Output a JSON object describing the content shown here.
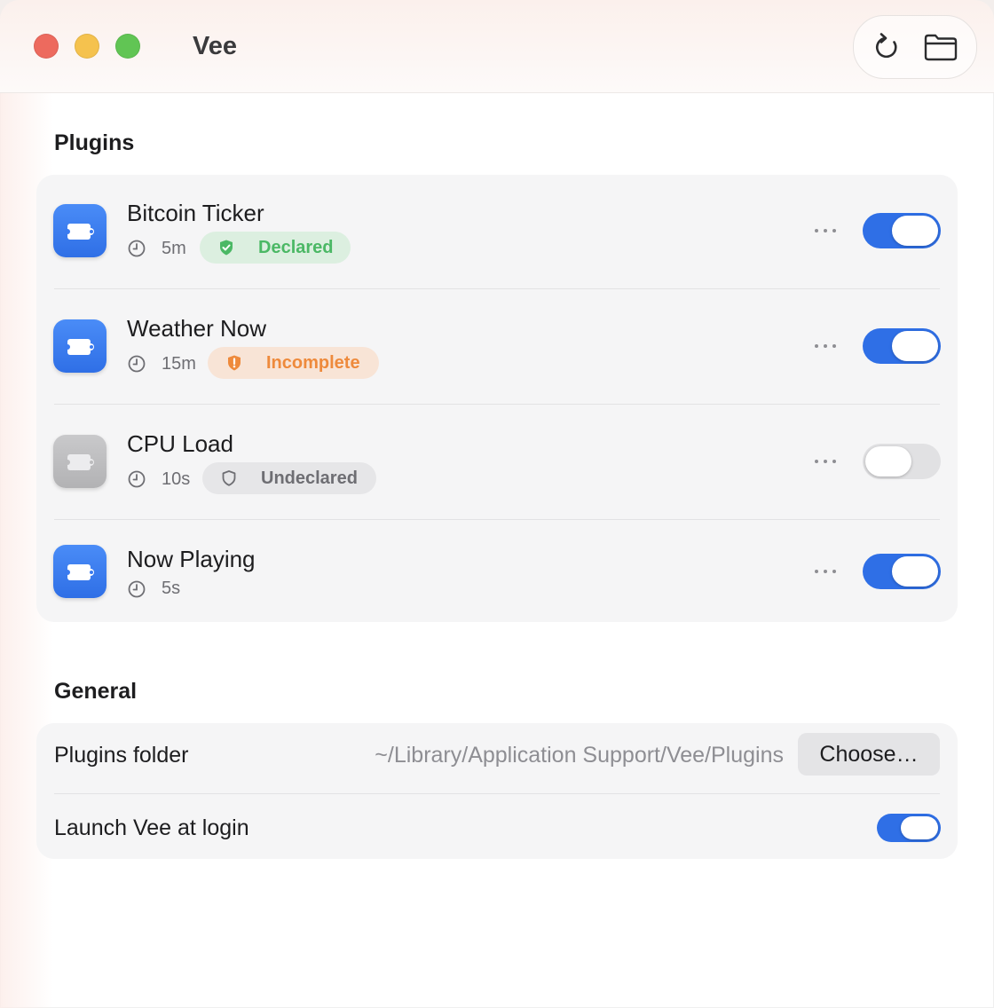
{
  "window": {
    "title": "Vee"
  },
  "toolbar": {
    "refresh_icon": "refresh-icon",
    "folder_icon": "folder-icon"
  },
  "plugins": {
    "section_title": "Plugins",
    "items": [
      {
        "name": "Bitcoin Ticker",
        "interval": "5m",
        "badge": "Declared",
        "enabled": true
      },
      {
        "name": "Weather Now",
        "interval": "15m",
        "badge": "Incomplete",
        "enabled": true
      },
      {
        "name": "CPU Load",
        "interval": "10s",
        "badge": "Undeclared",
        "enabled": false
      },
      {
        "name": "Now Playing",
        "interval": "5s",
        "enabled": true
      }
    ]
  },
  "general": {
    "section_title": "General",
    "plugins_folder_label": "Plugins folder",
    "plugins_folder_path": "~/Library/Application Support/Vee/Plugins",
    "choose_label": "Choose…",
    "launch_at_login_label": "Launch Vee at login",
    "launch_at_login": true
  },
  "colors": {
    "accent": "#2f6fe6",
    "declared": "#4bb865",
    "incomplete": "#ee8a3c",
    "undeclared": "#6e6e73"
  }
}
